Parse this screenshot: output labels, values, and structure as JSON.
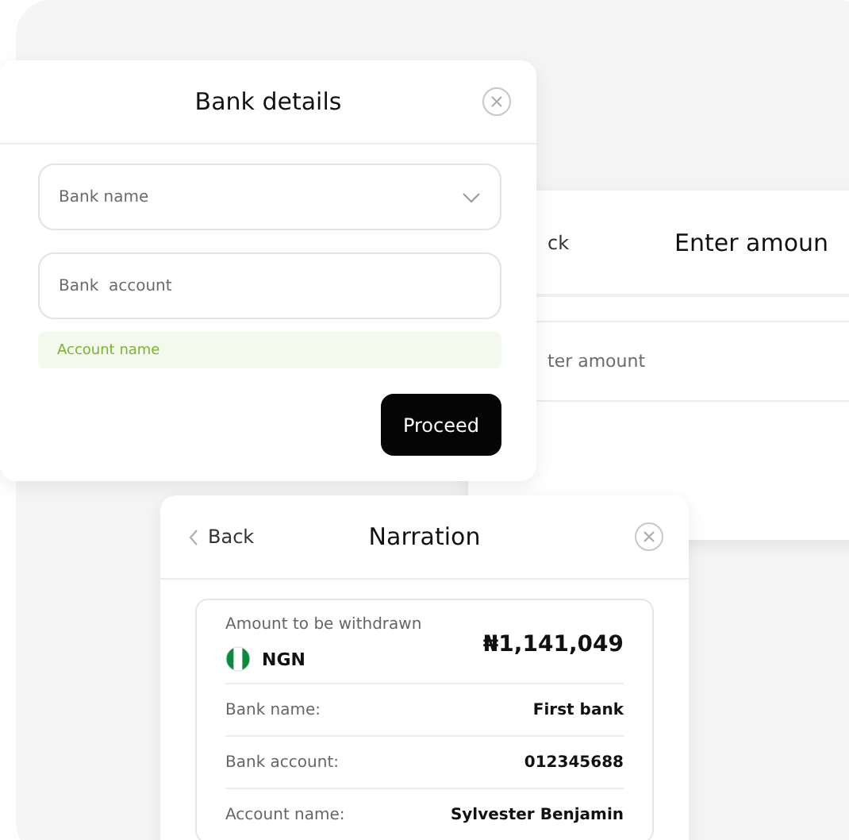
{
  "bank_details_dialog": {
    "title": "Bank details",
    "bank_name_field": {
      "placeholder": "Bank name"
    },
    "bank_account_field": {
      "placeholder": "Bank  account"
    },
    "account_name": "Account name",
    "proceed_button": "Proceed"
  },
  "enter_amount_dialog": {
    "back_label": "ck",
    "title": "Enter amoun",
    "amount_field": {
      "placeholder": "ter amount"
    }
  },
  "narration_dialog": {
    "back_label": "Back",
    "title": "Narration",
    "amount_label": "Amount to be withdrawn",
    "currency": "NGN",
    "amount": "₦1,141,049",
    "rows": [
      {
        "label": "Bank name:",
        "value": "First bank"
      },
      {
        "label": "Bank account:",
        "value": "012345688"
      },
      {
        "label": "Account name:",
        "value": "Sylvester Benjamin"
      }
    ]
  }
}
